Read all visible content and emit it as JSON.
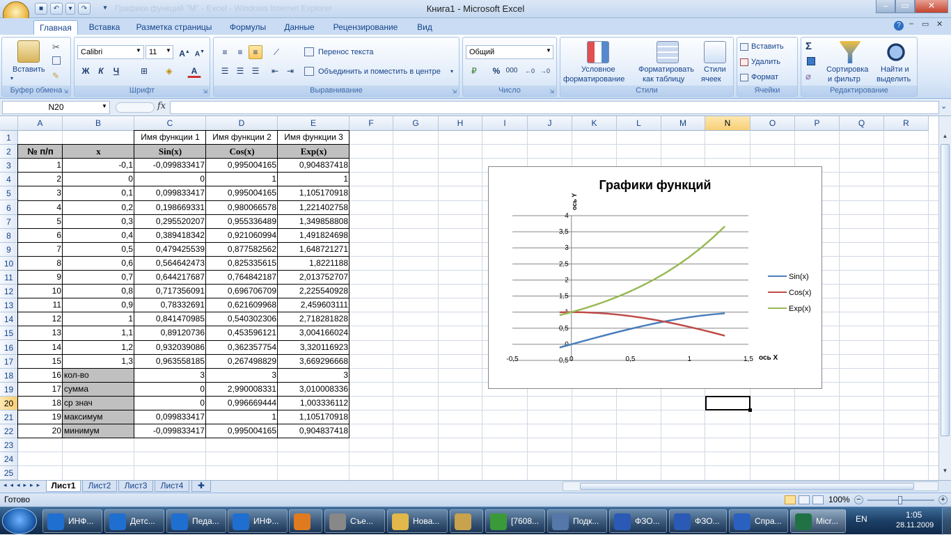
{
  "window": {
    "title": "Книга1 - Microsoft Excel",
    "ghost_title": "Графики функций \"М\" - Excel - Windows Internet Explorer"
  },
  "ribbon": {
    "tabs": [
      "Главная",
      "Вставка",
      "Разметка страницы",
      "Формулы",
      "Данные",
      "Рецензирование",
      "Вид"
    ],
    "active_tab": "Главная",
    "clipboard": {
      "paste": "Вставить",
      "label": "Буфер обмена"
    },
    "font": {
      "name": "Calibri",
      "size": "11",
      "label": "Шрифт",
      "bold": "Ж",
      "italic": "К",
      "underline": "Ч"
    },
    "alignment": {
      "wrap": "Перенос текста",
      "merge": "Объединить и поместить в центре",
      "label": "Выравнивание"
    },
    "number": {
      "format": "Общий",
      "label": "Число",
      "percent": "%",
      "thousands": "000"
    },
    "styles": {
      "cond1": "Условное",
      "cond2": "форматирование",
      "table1": "Форматировать",
      "table2": "как таблицу",
      "cell1": "Стили",
      "cell2": "ячеек",
      "label": "Стили"
    },
    "cells": {
      "insert": "Вставить",
      "delete": "Удалить",
      "format": "Формат",
      "label": "Ячейки"
    },
    "editing": {
      "sort1": "Сортировка",
      "sort2": "и фильтр",
      "find1": "Найти и",
      "find2": "выделить",
      "label": "Редактирование",
      "sigma": "Σ"
    }
  },
  "formula_bar": {
    "name_box": "N20",
    "fx": "fx",
    "value": ""
  },
  "columns": [
    "A",
    "B",
    "C",
    "D",
    "E",
    "F",
    "G",
    "H",
    "I",
    "J",
    "K",
    "L",
    "M",
    "N",
    "O",
    "P",
    "Q",
    "R"
  ],
  "selected_column": "N",
  "rows": [
    "1",
    "2",
    "3",
    "4",
    "5",
    "6",
    "7",
    "8",
    "9",
    "10",
    "11",
    "12",
    "13",
    "14",
    "15",
    "16",
    "17",
    "18",
    "19",
    "20",
    "21",
    "22",
    "23",
    "24",
    "25"
  ],
  "selected_row": "20",
  "table": {
    "row1": [
      "",
      "",
      "Имя функции 1",
      "Имя функции 2",
      "Имя функции 3"
    ],
    "headers": [
      "№ п/п",
      "x",
      "Sin(x)",
      "Cos(x)",
      "Exp(x)"
    ],
    "data": [
      [
        "1",
        "-0,1",
        "-0,099833417",
        "0,995004165",
        "0,904837418"
      ],
      [
        "2",
        "0",
        "0",
        "1",
        "1"
      ],
      [
        "3",
        "0,1",
        "0,099833417",
        "0,995004165",
        "1,105170918"
      ],
      [
        "4",
        "0,2",
        "0,198669331",
        "0,980066578",
        "1,221402758"
      ],
      [
        "5",
        "0,3",
        "0,295520207",
        "0,955336489",
        "1,349858808"
      ],
      [
        "6",
        "0,4",
        "0,389418342",
        "0,921060994",
        "1,491824698"
      ],
      [
        "7",
        "0,5",
        "0,479425539",
        "0,877582562",
        "1,648721271"
      ],
      [
        "8",
        "0,6",
        "0,564642473",
        "0,825335615",
        "1,8221188"
      ],
      [
        "9",
        "0,7",
        "0,644217687",
        "0,764842187",
        "2,013752707"
      ],
      [
        "10",
        "0,8",
        "0,717356091",
        "0,696706709",
        "2,225540928"
      ],
      [
        "11",
        "0,9",
        "0,78332691",
        "0,621609968",
        "2,459603111"
      ],
      [
        "12",
        "1",
        "0,841470985",
        "0,540302306",
        "2,718281828"
      ],
      [
        "13",
        "1,1",
        "0,89120736",
        "0,453596121",
        "3,004166024"
      ],
      [
        "14",
        "1,2",
        "0,932039086",
        "0,362357754",
        "3,320116923"
      ],
      [
        "15",
        "1,3",
        "0,963558185",
        "0,267498829",
        "3,669296668"
      ]
    ],
    "stats": [
      [
        "16",
        "кол-во",
        "3",
        "3",
        "3"
      ],
      [
        "17",
        "сумма",
        "0",
        "2,990008331",
        "3,010008336"
      ],
      [
        "18",
        "ср знач",
        "0",
        "0,996669444",
        "1,003336112"
      ],
      [
        "19",
        "максимум",
        "0,099833417",
        "1",
        "1,105170918"
      ],
      [
        "20",
        "минимум",
        "-0,099833417",
        "0,995004165",
        "0,904837418"
      ]
    ]
  },
  "chart_data": {
    "type": "scatter",
    "title": "Графики функций",
    "xlabel": "ось X",
    "ylabel": "ось Y",
    "xlim": [
      -0.5,
      1.5
    ],
    "ylim": [
      -0.5,
      4
    ],
    "x_ticks": [
      "-0,5",
      "0",
      "0,5",
      "1",
      "1,5"
    ],
    "y_ticks": [
      "-0,5",
      "0",
      "0,5",
      "1",
      "1,5",
      "2",
      "2,5",
      "3",
      "3,5",
      "4"
    ],
    "legend_position": "right",
    "x": [
      -0.1,
      0,
      0.1,
      0.2,
      0.3,
      0.4,
      0.5,
      0.6,
      0.7,
      0.8,
      0.9,
      1,
      1.1,
      1.2,
      1.3
    ],
    "series": [
      {
        "name": "Sin(x)",
        "color": "#4a7ebb",
        "values": [
          -0.0998,
          0,
          0.0998,
          0.1987,
          0.2955,
          0.3894,
          0.4794,
          0.5646,
          0.6442,
          0.7174,
          0.7833,
          0.8415,
          0.8912,
          0.932,
          0.9636
        ]
      },
      {
        "name": "Cos(x)",
        "color": "#be4b48",
        "values": [
          0.995,
          1,
          0.995,
          0.9801,
          0.9553,
          0.9211,
          0.8776,
          0.8253,
          0.7648,
          0.6967,
          0.6216,
          0.5403,
          0.4536,
          0.3624,
          0.2675
        ]
      },
      {
        "name": "Exp(x)",
        "color": "#98b954",
        "values": [
          0.9048,
          1,
          1.1052,
          1.2214,
          1.3499,
          1.4918,
          1.6487,
          1.8221,
          2.0138,
          2.2255,
          2.4596,
          2.7183,
          3.0042,
          3.3201,
          3.6693
        ]
      }
    ]
  },
  "sheets": [
    "Лист1",
    "Лист2",
    "Лист3",
    "Лист4"
  ],
  "active_sheet": "Лист1",
  "status": {
    "ready": "Готово",
    "zoom": "100%"
  },
  "taskbar": {
    "items": [
      "ИНФ...",
      "Детс...",
      "Педа...",
      "ИНФ...",
      "",
      "Съе...",
      "Нова...",
      "",
      "[7608...",
      "Подк...",
      "ФЗО...",
      "ФЗО...",
      "Спра...",
      "Micr..."
    ],
    "lang": "EN",
    "time": "1:05",
    "date": "28.11.2009"
  }
}
